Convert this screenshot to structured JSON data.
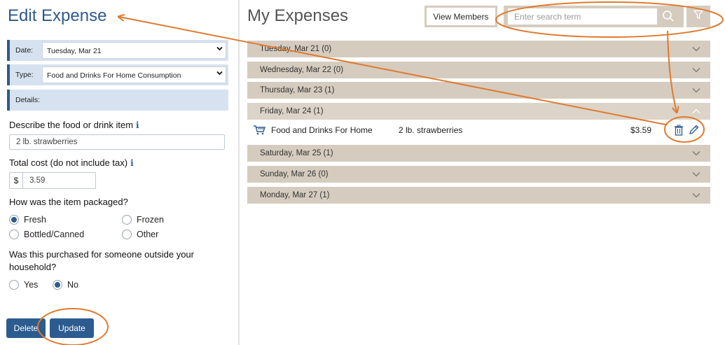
{
  "edit": {
    "title": "Edit Expense",
    "date_label": "Date:",
    "date_value": "Tuesday, Mar 21",
    "type_label": "Type:",
    "type_value": "Food and Drinks For Home Consumption",
    "details_label": "Details:",
    "q_describe": "Describe the food or drink item",
    "describe_value": "2 lb. strawberries",
    "q_cost": "Total cost (do not include tax)",
    "currency": "$",
    "cost_value": "3.59",
    "q_packaged": "How was the item packaged?",
    "packaging_options": [
      "Fresh",
      "Frozen",
      "Bottled/Canned",
      "Other"
    ],
    "packaging_selected": "Fresh",
    "q_outside": "Was this purchased for someone outside your household?",
    "q_outside_line1": "Was this purchased for someone outside your",
    "q_outside_line2": "household?",
    "outside_options": [
      "Yes",
      "No"
    ],
    "outside_selected": "No",
    "delete_label": "Delete",
    "update_label": "Update",
    "info_glyph": "i"
  },
  "expenses": {
    "title": "My Expenses",
    "view_members_label": "View Members",
    "search_placeholder": "Enter search term",
    "days": [
      {
        "label": "Tuesday, Mar 21   (0)",
        "open": false
      },
      {
        "label": "Wednesday, Mar 22   (0)",
        "open": false
      },
      {
        "label": "Thursday, Mar 23   (1)",
        "open": false
      },
      {
        "label": "Friday, Mar 24   (1)",
        "open": true
      },
      {
        "label": "Saturday, Mar 25   (1)",
        "open": false
      },
      {
        "label": "Sunday, Mar 26   (0)",
        "open": false
      },
      {
        "label": "Monday, Mar 27   (1)",
        "open": false
      }
    ],
    "item": {
      "category": "Food and Drinks For Home",
      "description": "2 lb. strawberries",
      "price": "$3.59"
    }
  },
  "colors": {
    "primary": "#2c5b8f",
    "day_bar": "#d5ccbf",
    "annotation": "#e07a2e",
    "panel_row": "#d6e2ef"
  }
}
